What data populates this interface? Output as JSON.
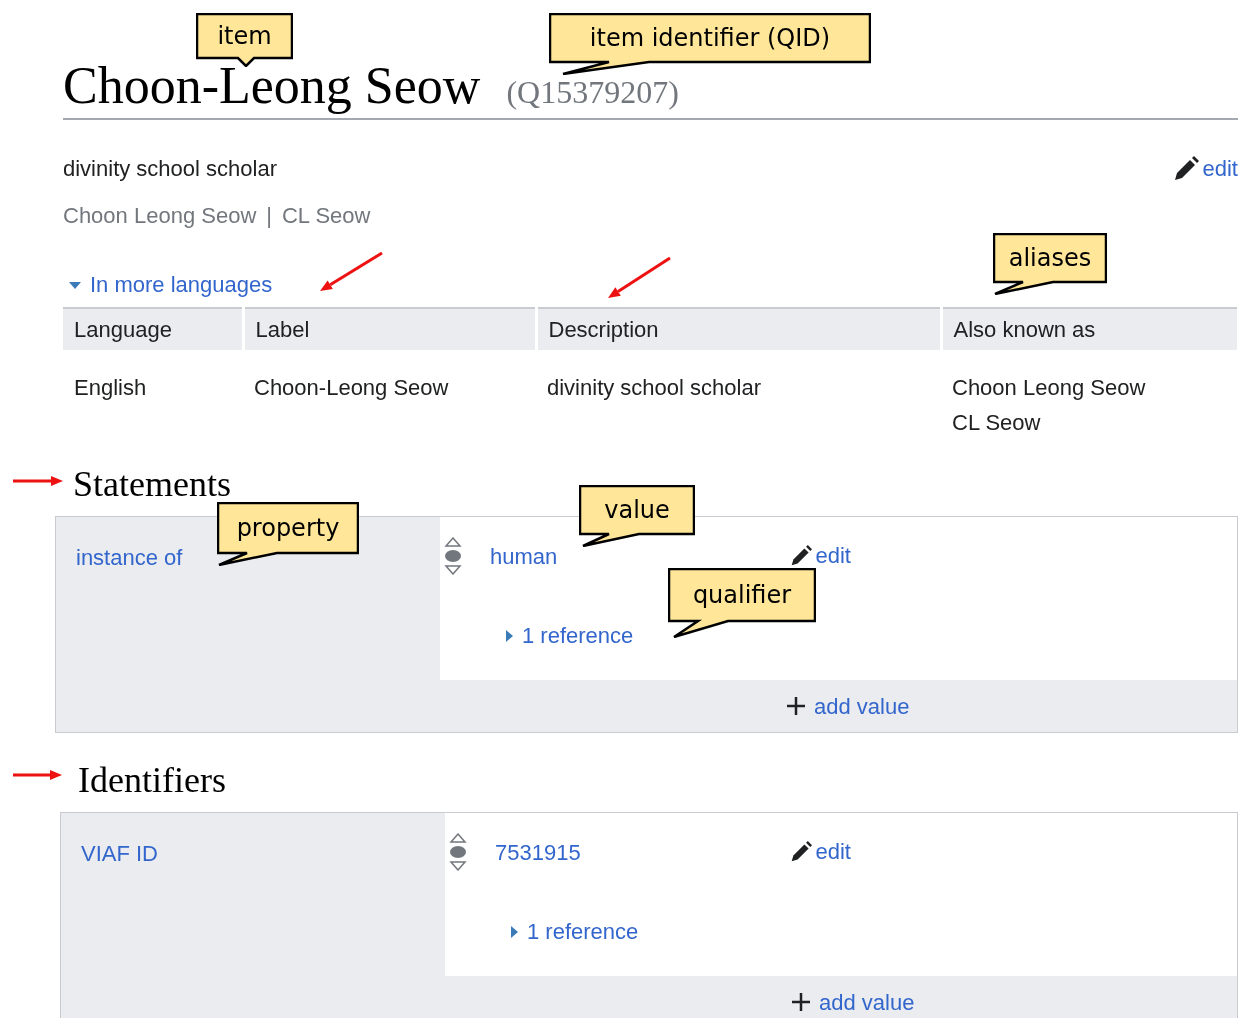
{
  "item": {
    "label": "Choon-Leong Seow",
    "qid": "(Q15379207)"
  },
  "description": "divinity school scholar",
  "aliases": [
    "Choon Leong Seow",
    "CL Seow"
  ],
  "alias_separator": "|",
  "header_edit": "edit",
  "languages_toggle": {
    "label": "In more languages",
    "expanded": true
  },
  "languages_table": {
    "columns": [
      "Language",
      "Label",
      "Description",
      "Also known as"
    ],
    "rows": [
      {
        "language": "English",
        "label": "Choon-Leong Seow",
        "description": "divinity school scholar",
        "aliases": [
          "Choon Leong Seow",
          "CL Seow"
        ]
      }
    ]
  },
  "sections": [
    {
      "title": "Statements",
      "statements": [
        {
          "property": "instance of",
          "value": "human",
          "edit": "edit",
          "references": {
            "label": "1 reference",
            "expanded": false
          },
          "add_value": "add value"
        }
      ]
    },
    {
      "title": "Identifiers",
      "statements": [
        {
          "property": "VIAF ID",
          "value": "7531915",
          "edit": "edit",
          "references": {
            "label": "1 reference",
            "expanded": false
          },
          "add_value": "add value"
        }
      ]
    }
  ],
  "annotations": [
    {
      "text": "item"
    },
    {
      "text": "item identifier (QID)"
    },
    {
      "text": "aliases"
    },
    {
      "text": "property"
    },
    {
      "text": "value"
    },
    {
      "text": "qualifier"
    }
  ]
}
